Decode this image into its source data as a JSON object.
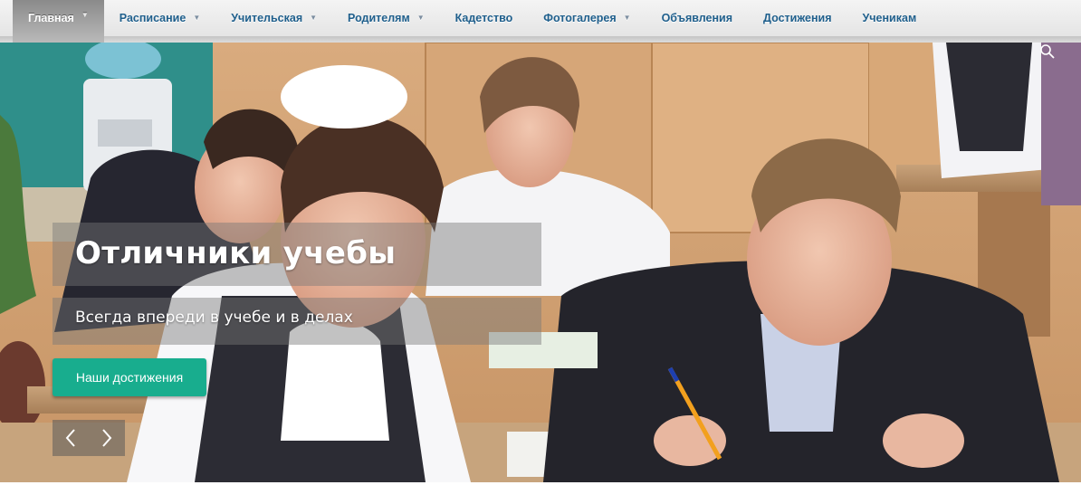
{
  "nav": {
    "items": [
      {
        "label": "Главная",
        "dropdown": true,
        "active": true
      },
      {
        "label": "Расписание",
        "dropdown": true
      },
      {
        "label": "Учительская",
        "dropdown": true
      },
      {
        "label": "Родителям",
        "dropdown": true
      },
      {
        "label": "Кадетство",
        "dropdown": false
      },
      {
        "label": "Фотогалерея",
        "dropdown": true
      },
      {
        "label": "Объявления",
        "dropdown": false
      },
      {
        "label": "Достижения",
        "dropdown": false
      },
      {
        "label": "Ученикам",
        "dropdown": false
      }
    ]
  },
  "slider": {
    "title": "Отличники учебы",
    "subtitle": "Всегда впереди в учебе и в делах",
    "button_label": "Наши достижения",
    "prev_icon": "chevron-left-icon",
    "next_icon": "chevron-right-icon",
    "search_icon": "search-icon"
  },
  "colors": {
    "nav_text": "#1f5f8c",
    "nav_active_bg": "#9a9a9a",
    "button_accent": "#18ad8e"
  }
}
